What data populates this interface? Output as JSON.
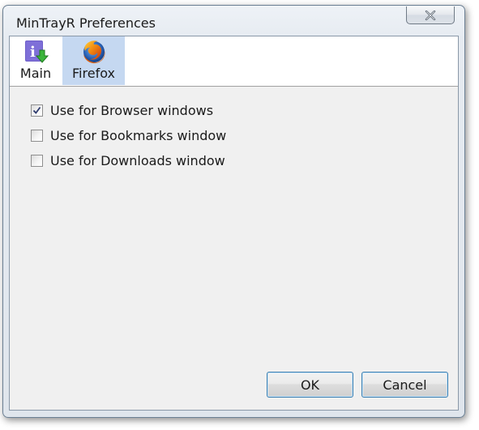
{
  "window": {
    "title": "MinTrayR Preferences"
  },
  "tabs": [
    {
      "label": "Main",
      "icon": "info-download-icon",
      "selected": false
    },
    {
      "label": "Firefox",
      "icon": "firefox-icon",
      "selected": true
    }
  ],
  "options": [
    {
      "label": "Use for Browser windows",
      "checked": true
    },
    {
      "label": "Use for Bookmarks window",
      "checked": false
    },
    {
      "label": "Use for Downloads window",
      "checked": false
    }
  ],
  "buttons": {
    "ok_label": "OK",
    "cancel_label": "Cancel"
  },
  "colors": {
    "selected_tab": "#c5d8f1",
    "client_background": "#f0f0f0",
    "button_border": "#3c7fb1"
  }
}
